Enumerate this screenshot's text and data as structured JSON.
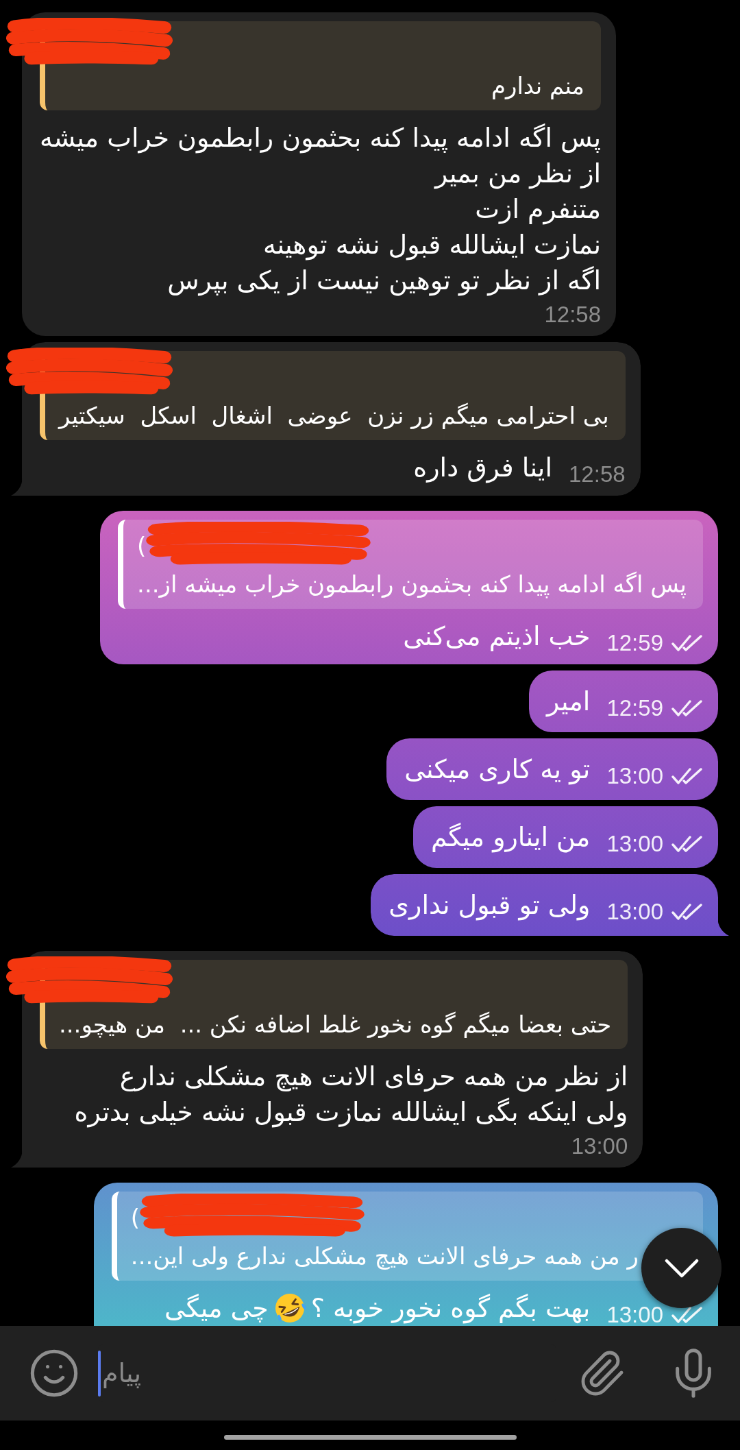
{
  "messages": [
    {
      "kind": "incoming",
      "tail": false,
      "reply": {
        "author_redacted": true,
        "text": "منم ندارم"
      },
      "text": "پس اگه ادامه پیدا کنه بحثمون رابطمون خراب میشه\nاز نظر من بمیر\nمتنفرم ازت\nنمازت ایشالله قبول نشه توهینه\nاگه از نظر تو توهین نیست از یکی بپرس",
      "time": "12:58"
    },
    {
      "kind": "incoming",
      "tail": true,
      "reply": {
        "author_redacted": true,
        "text": "بی احترامی میگم زر نزن  عوضی  اشغال  اسکل  سیکتیر"
      },
      "text": "اینا فرق داره",
      "time": "12:58"
    },
    {
      "kind": "outgoing",
      "tail": false,
      "reply": {
        "author": "(",
        "author_redacted": true,
        "text": "پس اگه ادامه پیدا کنه بحثمون رابطمون خراب میشه از..."
      },
      "text": "خب اذیتم می‌کنی",
      "time": "12:59",
      "read": true
    },
    {
      "kind": "outgoing",
      "tail": false,
      "text": "امیر",
      "time": "12:59",
      "read": true
    },
    {
      "kind": "outgoing",
      "tail": false,
      "text": "تو یه کاری میکنی",
      "time": "13:00",
      "read": true
    },
    {
      "kind": "outgoing",
      "tail": false,
      "text": "من اینارو میگم",
      "time": "13:00",
      "read": true
    },
    {
      "kind": "outgoing",
      "tail": true,
      "text": "ولی تو قبول نداری",
      "time": "13:00",
      "read": true
    },
    {
      "kind": "incoming",
      "tail": true,
      "reply": {
        "author_redacted": true,
        "text": "حتی بعضا میگم گوه نخور غلط اضافه نکن ...  من هیچو..."
      },
      "text": "از نظر من همه حرفای الانت هیچ مشکلی ندارع\nولی اینکه بگی ایشالله نمازت قبول نشه خیلی بدتره",
      "time": "13:00"
    },
    {
      "kind": "outgoing",
      "reply": {
        "author": "(",
        "author_redacted": true,
        "text": "ر من همه حرفای الانت هیچ مشکلی ندارع ولی این..."
      },
      "parts": [
        {
          "kind": "text",
          "text": "بهت بگم گوه نخور خوبه ؟"
        },
        {
          "kind": "emoji"
        },
        {
          "kind": "text",
          "text": "چی میگی"
        }
      ],
      "time": "13:00",
      "read": true
    }
  ],
  "composer": {
    "placeholder": "پیام",
    "focused": true
  }
}
